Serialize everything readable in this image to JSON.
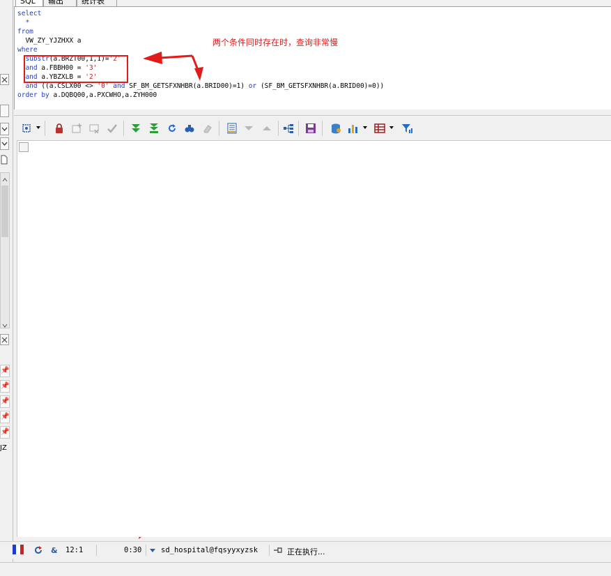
{
  "tabs": [
    "SQL",
    "输出",
    "统计表"
  ],
  "editor": {
    "lines": {
      "l1": "select",
      "l2": "  *",
      "l3": "from",
      "l4": "  VW_ZY_YJZHXX a",
      "l5": "where",
      "l6a": "  substr",
      "l6b": "(a.BRZT00,1,1)=",
      "l6c": "'2'",
      "l7a": "  and",
      "l7b": " a.FBBH00 = ",
      "l7c": "'3'",
      "l8a": "  and",
      "l8b": " a.YBZXLB = ",
      "l8c": "'2'",
      "l9a": "  and",
      "l9b": " ((a.CSLX00 <> ",
      "l9c": "'0'",
      "l9d": " and",
      "l9e": " SF_BM_GETSFXNHBR(a.BRID00)=1) ",
      "l9f": "or",
      "l9g": " (SF_BM_GETSFXNHBR(a.BRID00)=0))",
      "l10a": "order by",
      "l10b": " a.DQBQ00,a.PXCWHO,a.ZYH000"
    },
    "annotation_text": "两个条件同时存在时，查询非常慢"
  },
  "left_panel": {
    "label": "JZ"
  },
  "status": {
    "cursor_position": "12:1",
    "elapsed_time": "0:30",
    "connection": "sd_hospital@fqsyyxyzsk",
    "state_text": "正在执行..."
  },
  "colors": {
    "keyword": "#1f3cc9",
    "string": "#c02020",
    "annotation": "#e21a1a"
  },
  "icons": [
    "select-icon",
    "lock-icon",
    "add-record-icon",
    "delete-record-icon",
    "post-icon",
    "fetch-next-icon",
    "fetch-last-icon",
    "refresh-icon",
    "find-icon",
    "clear-icon",
    "single-record-icon",
    "next-record-icon",
    "previous-record-icon",
    "query-by-example-icon",
    "save-icon",
    "export-icon",
    "chart-icon",
    "grid-view-icon",
    "filter-icon"
  ]
}
